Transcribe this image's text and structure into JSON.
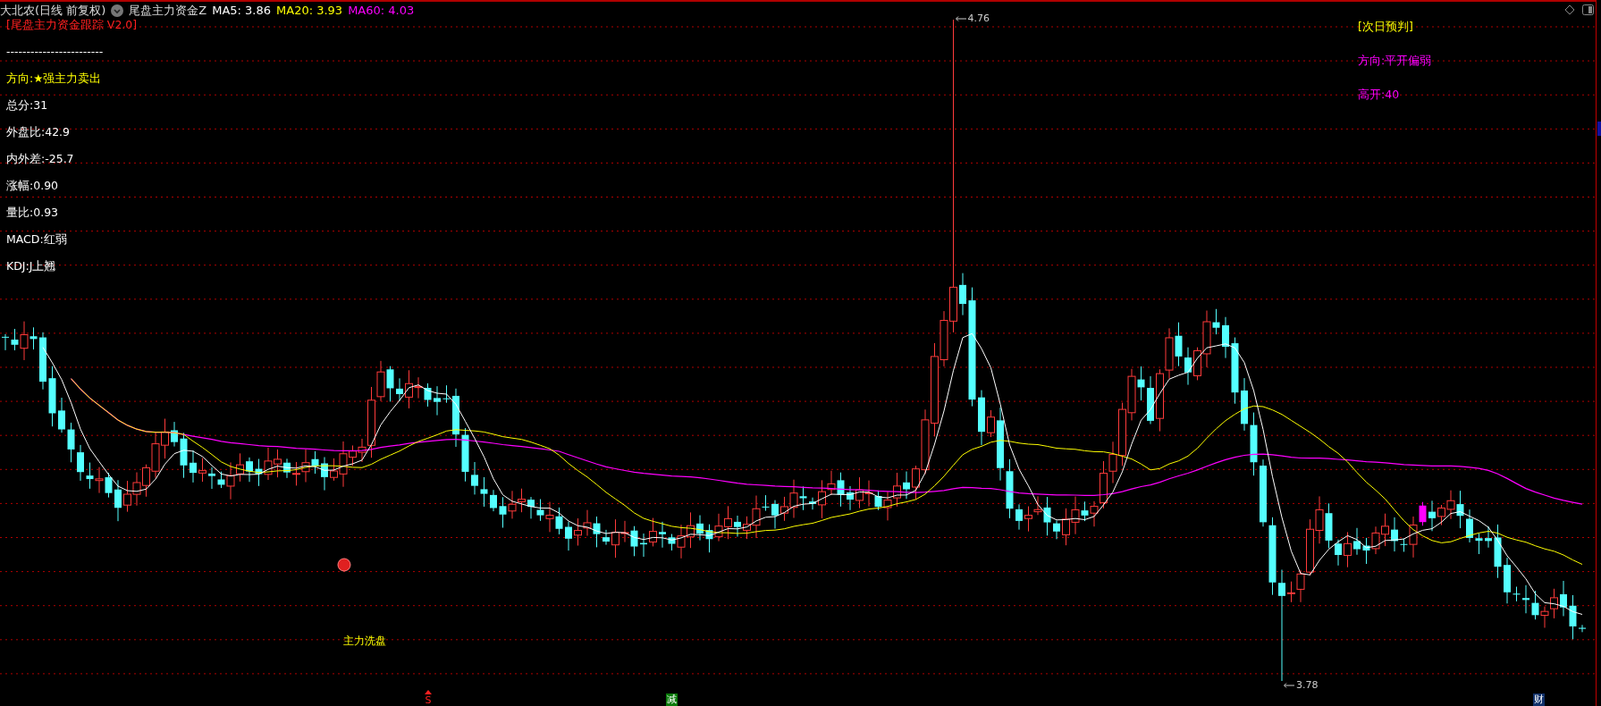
{
  "header": {
    "stock": "大北农(日线 前复权)",
    "indicator": "尾盘主力资金Z",
    "averages": [
      {
        "label": "MA5: 3.86",
        "color": "#ffffff"
      },
      {
        "label": "MA20: 3.93",
        "color": "#ffff00"
      },
      {
        "label": "MA60: 4.03",
        "color": "#ff00ff"
      }
    ]
  },
  "panel": {
    "title": "[尾盘主力资金跟踪 V2.0]",
    "separator": "------------------------",
    "lines": [
      {
        "text": "方向:★强主力卖出",
        "kind": "highlight"
      },
      {
        "text": "总分:31",
        "kind": "plain"
      },
      {
        "text": "外盘比:42.9",
        "kind": "plain"
      },
      {
        "text": "内外差:-25.7",
        "kind": "plain"
      },
      {
        "text": "涨幅:0.90",
        "kind": "plain"
      },
      {
        "text": "量比:0.93",
        "kind": "plain"
      },
      {
        "text": "MACD:红弱",
        "kind": "plain"
      },
      {
        "text": "KDJ:J上翘",
        "kind": "plain"
      }
    ]
  },
  "forecast": {
    "title": "[次日预判]",
    "lines": [
      "方向:平开偏弱",
      "高开:40"
    ]
  },
  "chart": {
    "high_label": "4.76",
    "low_label": "3.78",
    "annotation": "主力洗盘",
    "markers": [
      {
        "text": "S",
        "kind": "sell"
      },
      {
        "text": "减",
        "kind": "reduce"
      },
      {
        "text": "财",
        "kind": "finance"
      }
    ]
  }
}
